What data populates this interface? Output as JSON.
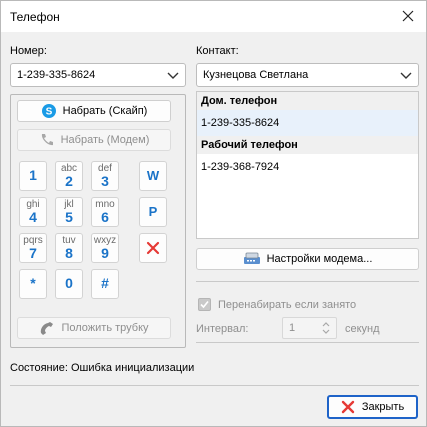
{
  "window": {
    "title": "Телефон"
  },
  "number": {
    "label": "Номер:",
    "value": "1-239-335-8624"
  },
  "contact": {
    "label": "Контакт:",
    "value": "Кузнецова Светлана"
  },
  "buttons": {
    "dial_skype": "Набрать (Скайп)",
    "dial_modem": "Набрать (Модем)",
    "hang_up": "Положить трубку",
    "modem_settings": "Настройки модема...",
    "close": "Закрыть"
  },
  "keys": [
    {
      "sub": "",
      "num": "1"
    },
    {
      "sub": "abc",
      "num": "2"
    },
    {
      "sub": "def",
      "num": "3"
    },
    {
      "sub": "ghi",
      "num": "4"
    },
    {
      "sub": "jkl",
      "num": "5"
    },
    {
      "sub": "mno",
      "num": "6"
    },
    {
      "sub": "pqrs",
      "num": "7"
    },
    {
      "sub": "tuv",
      "num": "8"
    },
    {
      "sub": "wxyz",
      "num": "9"
    },
    {
      "sub": "",
      "num": "*"
    },
    {
      "sub": "",
      "num": "0"
    },
    {
      "sub": "",
      "num": "#"
    }
  ],
  "side_keys": {
    "w": "W",
    "p": "P"
  },
  "phones": [
    {
      "heading": "Дом. телефон",
      "number": "1-239-335-8624"
    },
    {
      "heading": "Рабочий телефон",
      "number": "1-239-368-7924"
    }
  ],
  "redial": {
    "label": "Перенабирать если занято",
    "checked": true,
    "enabled": false
  },
  "interval": {
    "label": "Интервал:",
    "value": "1",
    "unit": "секунд"
  },
  "status": {
    "text": "Состояние: Ошибка инициализации"
  },
  "colors": {
    "key_digit": "#1a73c8",
    "accent_border": "#1e63c8",
    "clear_icon": "#e53935",
    "close_icon": "#e53935"
  }
}
